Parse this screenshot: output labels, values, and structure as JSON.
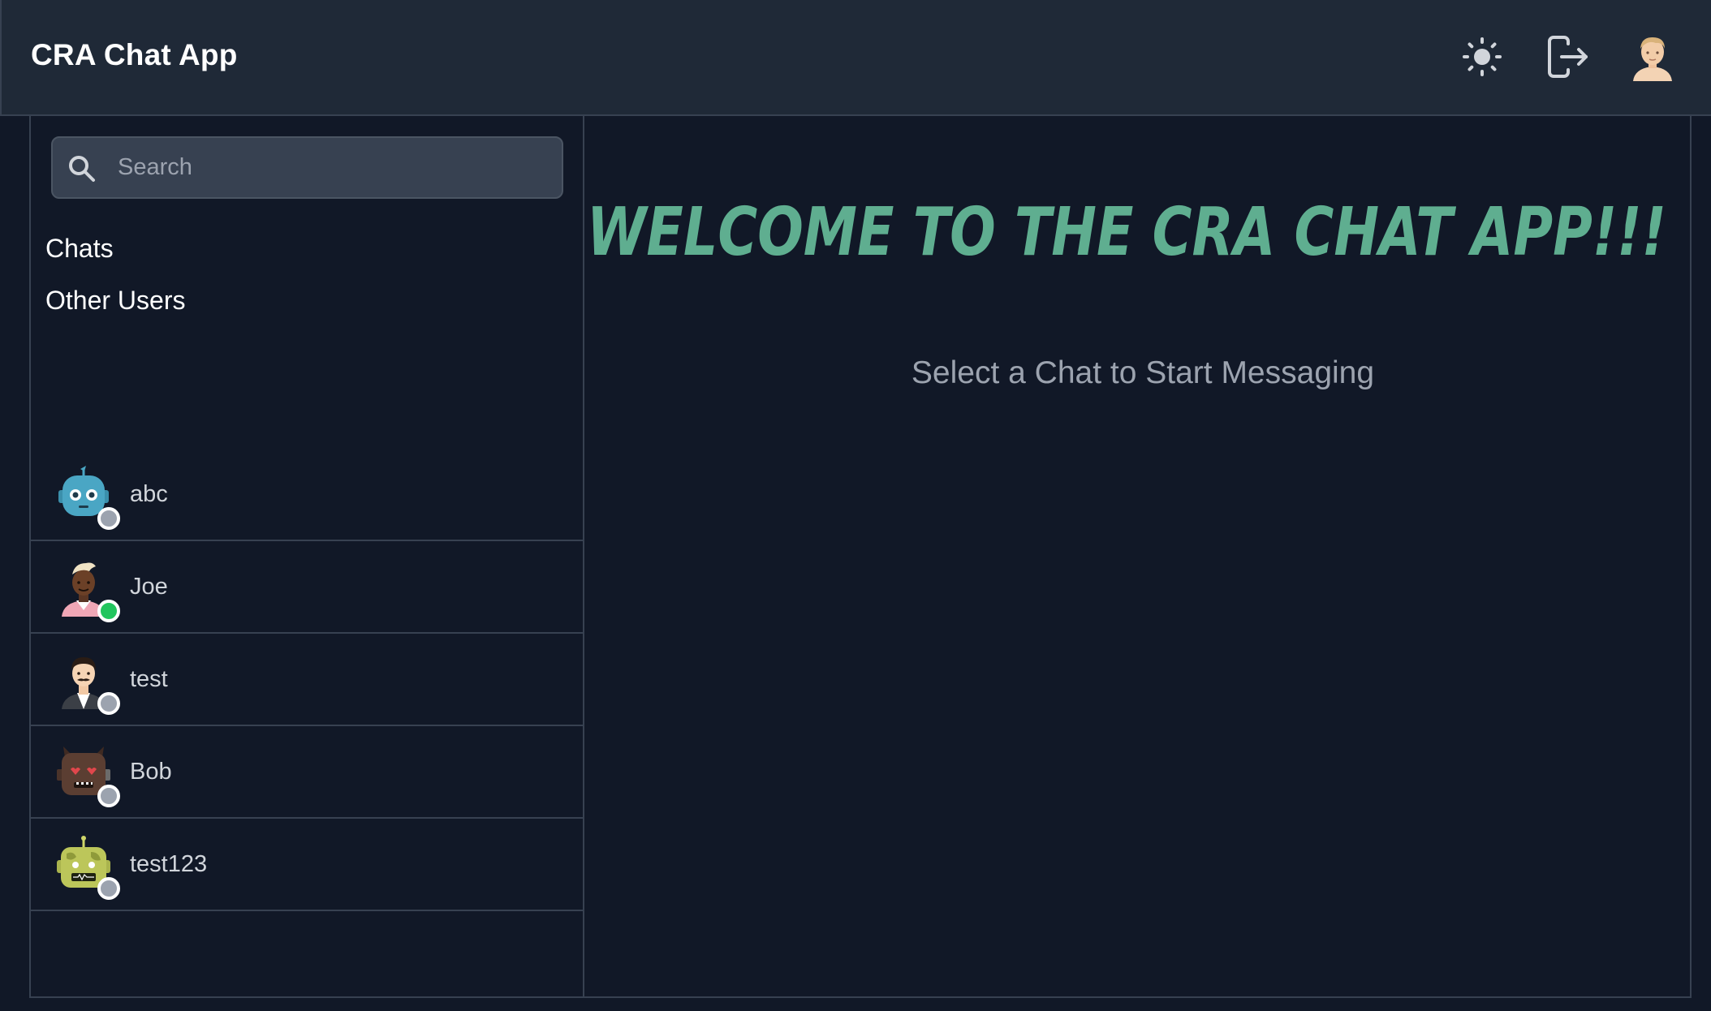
{
  "header": {
    "title": "CRA Chat App",
    "theme_icon": "sun-icon",
    "logout_icon": "logout-icon",
    "avatar_icon": "user-avatar"
  },
  "sidebar": {
    "search_placeholder": "Search",
    "chats_label": "Chats",
    "other_users_label": "Other Users",
    "users": [
      {
        "name": "abc",
        "online": false,
        "avatar": "robot-blue-avatar"
      },
      {
        "name": "Joe",
        "online": true,
        "avatar": "man-dark-skin-avatar"
      },
      {
        "name": "test",
        "online": false,
        "avatar": "man-mustache-avatar"
      },
      {
        "name": "Bob",
        "online": false,
        "avatar": "robot-brown-heart-eyes-avatar"
      },
      {
        "name": "test123",
        "online": false,
        "avatar": "robot-green-avatar"
      }
    ]
  },
  "main": {
    "welcome_text": "WELCOME TO THE CRA CHAT APP!!!",
    "subtitle": "Select a Chat to Start Messaging"
  },
  "colors": {
    "accent": "#5fae90",
    "online": "#22c55e",
    "offline": "#9ca3af",
    "background": "#111827",
    "header": "#1f2937"
  }
}
